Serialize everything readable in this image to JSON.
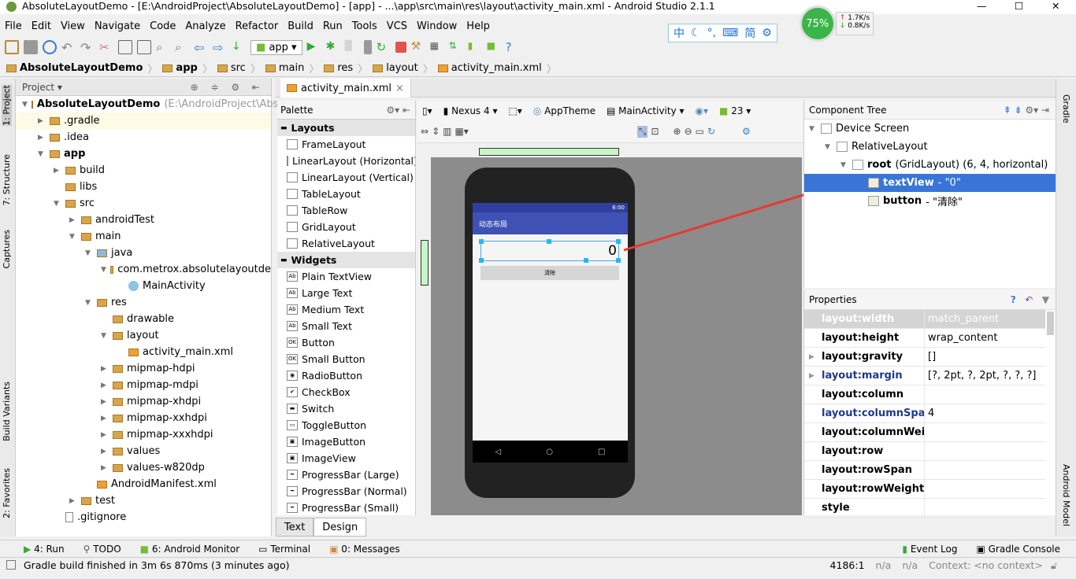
{
  "window": {
    "title": "AbsoluteLayoutDemo - [E:\\AndroidProject\\AbsoluteLayoutDemo] - [app] - ...\\app\\src\\main\\res\\layout\\activity_main.xml - Android Studio 2.1.1"
  },
  "menu": [
    "File",
    "Edit",
    "View",
    "Navigate",
    "Code",
    "Analyze",
    "Refactor",
    "Build",
    "Run",
    "Tools",
    "VCS",
    "Window",
    "Help"
  ],
  "toolbar": {
    "run_config": "app"
  },
  "net_meter": {
    "percent": "75%",
    "up": "1.7K/s",
    "down": "0.8K/s",
    "ime_chars": [
      "中",
      "简"
    ]
  },
  "breadcrumb": [
    "AbsoluteLayoutDemo",
    "app",
    "src",
    "main",
    "res",
    "layout",
    "activity_main.xml"
  ],
  "left_strip": [
    "1: Project",
    "7: Structure",
    "Captures",
    "Build Variants",
    "2: Favorites"
  ],
  "right_strip": [
    "Gradle",
    "Android Model"
  ],
  "project": {
    "header": "Project",
    "items": [
      {
        "label": "AbsoluteLayoutDemo",
        "extra": "(E:\\AndroidProject\\Abso",
        "depth": 0,
        "arrow": "▼",
        "bold": true
      },
      {
        "label": ".gradle",
        "depth": 1,
        "arrow": "▶",
        "sel": true
      },
      {
        "label": ".idea",
        "depth": 1,
        "arrow": "▶"
      },
      {
        "label": "app",
        "depth": 1,
        "arrow": "▼",
        "bold": true
      },
      {
        "label": "build",
        "depth": 2,
        "arrow": "▶"
      },
      {
        "label": "libs",
        "depth": 2,
        "arrow": ""
      },
      {
        "label": "src",
        "depth": 2,
        "arrow": "▼"
      },
      {
        "label": "androidTest",
        "depth": 3,
        "arrow": "▶"
      },
      {
        "label": "main",
        "depth": 3,
        "arrow": "▼"
      },
      {
        "label": "java",
        "depth": 4,
        "arrow": "▼"
      },
      {
        "label": "com.metrox.absolutelayoutde",
        "depth": 5,
        "arrow": "▼"
      },
      {
        "label": "MainActivity",
        "depth": 6,
        "arrow": "",
        "icon": "class"
      },
      {
        "label": "res",
        "depth": 4,
        "arrow": "▼"
      },
      {
        "label": "drawable",
        "depth": 5,
        "arrow": ""
      },
      {
        "label": "layout",
        "depth": 5,
        "arrow": "▼"
      },
      {
        "label": "activity_main.xml",
        "depth": 6,
        "arrow": "",
        "icon": "xml"
      },
      {
        "label": "mipmap-hdpi",
        "depth": 5,
        "arrow": "▶"
      },
      {
        "label": "mipmap-mdpi",
        "depth": 5,
        "arrow": "▶"
      },
      {
        "label": "mipmap-xhdpi",
        "depth": 5,
        "arrow": "▶"
      },
      {
        "label": "mipmap-xxhdpi",
        "depth": 5,
        "arrow": "▶"
      },
      {
        "label": "mipmap-xxxhdpi",
        "depth": 5,
        "arrow": "▶"
      },
      {
        "label": "values",
        "depth": 5,
        "arrow": "▶"
      },
      {
        "label": "values-w820dp",
        "depth": 5,
        "arrow": "▶"
      },
      {
        "label": "AndroidManifest.xml",
        "depth": 4,
        "arrow": "",
        "icon": "xml"
      },
      {
        "label": "test",
        "depth": 3,
        "arrow": "▶"
      },
      {
        "label": ".gitignore",
        "depth": 2,
        "arrow": "",
        "icon": "file"
      }
    ]
  },
  "editor_tab": "activity_main.xml",
  "palette": {
    "header": "Palette",
    "items": [
      {
        "label": "Layouts",
        "cat": true
      },
      {
        "label": "FrameLayout"
      },
      {
        "label": "LinearLayout (Horizontal)"
      },
      {
        "label": "LinearLayout (Vertical)"
      },
      {
        "label": "TableLayout"
      },
      {
        "label": "TableRow"
      },
      {
        "label": "GridLayout"
      },
      {
        "label": "RelativeLayout"
      },
      {
        "label": "Widgets",
        "cat": true
      },
      {
        "label": "Plain TextView",
        "icon": "Ab"
      },
      {
        "label": "Large Text",
        "icon": "Ab"
      },
      {
        "label": "Medium Text",
        "icon": "Ab"
      },
      {
        "label": "Small Text",
        "icon": "Ab"
      },
      {
        "label": "Button",
        "icon": "OK"
      },
      {
        "label": "Small Button",
        "icon": "OK"
      },
      {
        "label": "RadioButton",
        "icon": "◉"
      },
      {
        "label": "CheckBox",
        "icon": "✔"
      },
      {
        "label": "Switch",
        "icon": "▬"
      },
      {
        "label": "ToggleButton",
        "icon": "▭"
      },
      {
        "label": "ImageButton",
        "icon": "▣"
      },
      {
        "label": "ImageView",
        "icon": "▣"
      },
      {
        "label": "ProgressBar (Large)",
        "icon": "━"
      },
      {
        "label": "ProgressBar (Normal)",
        "icon": "━"
      },
      {
        "label": "ProgressBar (Small)",
        "icon": "━"
      }
    ]
  },
  "design_toolbar": {
    "device": "Nexus 4",
    "theme": "AppTheme",
    "activity": "MainActivity",
    "api": "23"
  },
  "preview": {
    "time": "6:00",
    "app_title": "动态布局",
    "text_value": "0",
    "button_label": "清除"
  },
  "component_tree": {
    "header": "Component Tree",
    "items": [
      {
        "label": "Device Screen",
        "extra": "",
        "depth": 0
      },
      {
        "label": "RelativeLayout",
        "extra": "",
        "depth": 1
      },
      {
        "label": "root",
        "extra": " (GridLayout) (6, 4, horizontal)",
        "depth": 2,
        "bold": true
      },
      {
        "label": "textView",
        "extra": " - \"0\"",
        "depth": 3,
        "bold": true,
        "sel": true
      },
      {
        "label": "button",
        "extra": " - \"清除\"",
        "depth": 3,
        "bold": true
      }
    ]
  },
  "properties": {
    "header": "Properties",
    "rows": [
      {
        "key": "layout:width",
        "value": "match_parent",
        "sel": true
      },
      {
        "key": "layout:height",
        "value": "wrap_content"
      },
      {
        "key": "layout:gravity",
        "value": "[]",
        "expand": true
      },
      {
        "key": "layout:margin",
        "value": "[?, 2pt, ?, 2pt, ?, ?, ?]",
        "expand": true,
        "blue": true
      },
      {
        "key": "layout:column",
        "value": ""
      },
      {
        "key": "layout:columnSpan",
        "value": "4",
        "blue": true
      },
      {
        "key": "layout:columnWeight",
        "value": ""
      },
      {
        "key": "layout:row",
        "value": ""
      },
      {
        "key": "layout:rowSpan",
        "value": ""
      },
      {
        "key": "layout:rowWeight",
        "value": ""
      },
      {
        "key": "style",
        "value": ""
      }
    ]
  },
  "bottom_tabs": {
    "text": "Text",
    "design": "Design"
  },
  "tool_windows": [
    "4: Run",
    "TODO",
    "6: Android Monitor",
    "Terminal",
    "0: Messages"
  ],
  "tool_windows_right": [
    "Event Log",
    "Gradle Console"
  ],
  "status": {
    "message": "Gradle build finished in 3m 6s 870ms (3 minutes ago)",
    "position": "4186:1",
    "na1": "n/a",
    "na2": "n/a",
    "context": "Context: <no context>"
  },
  "colors": {
    "selection": "#3875d7",
    "accent_blue": "#1e3a8a",
    "app_bar": "#3f51b5",
    "arrow": "#e53935"
  }
}
